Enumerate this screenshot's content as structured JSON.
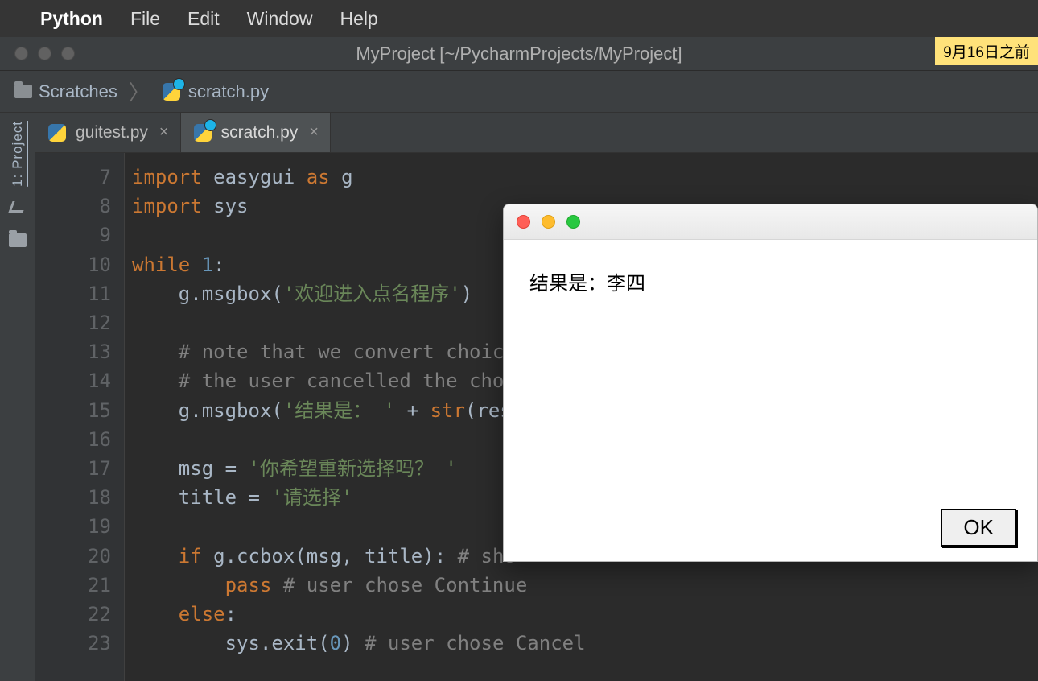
{
  "menubar": {
    "app": "Python",
    "items": [
      "File",
      "Edit",
      "Window",
      "Help"
    ]
  },
  "ide": {
    "title": "MyProject [~/PycharmProjects/MyProject]",
    "license_notice": "9月16日之前"
  },
  "breadcrumbs": {
    "root": "Scratches",
    "file": "scratch.py"
  },
  "sidebar": {
    "label": "1: Project"
  },
  "tabs": [
    {
      "label": "guitest.py",
      "active": false,
      "scratch": false
    },
    {
      "label": "scratch.py",
      "active": true,
      "scratch": true
    }
  ],
  "editor": {
    "first_line": 7,
    "lines": [
      "import easygui as g",
      "import sys",
      "",
      "while 1:",
      "    g.msgbox('欢迎进入点名程序')",
      "",
      "    # note that we convert choice",
      "    # the user cancelled the choi",
      "    g.msgbox('结果是： ' + str(resu",
      "",
      "    msg = '你希望重新选择吗？ '",
      "    title = '请选择'",
      "",
      "    if g.ccbox(msg, title): # sho",
      "        pass # user chose Continue",
      "    else:",
      "        sys.exit(0) # user chose Cancel"
    ]
  },
  "dialog": {
    "message": "结果是：李四",
    "ok_label": "OK"
  }
}
